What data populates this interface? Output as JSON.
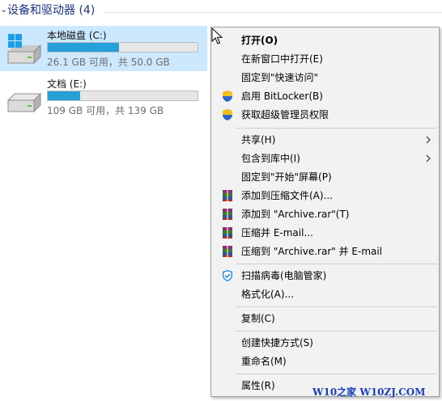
{
  "section": {
    "title": "设备和驱动器 (4)"
  },
  "drives": [
    {
      "name": "本地磁盘 (C:)",
      "info": "26.1 GB 可用，共 50.0 GB",
      "used_fraction": 0.478,
      "selected": true,
      "icon": "windows-drive-icon"
    },
    {
      "name": "文档 (E:)",
      "info": "109 GB 可用，共 139 GB",
      "used_fraction": 0.216,
      "selected": false,
      "icon": "hard-drive-icon"
    }
  ],
  "context_menu": {
    "items": [
      {
        "label": "打开(O)",
        "bold": true
      },
      {
        "label": "在新窗口中打开(E)"
      },
      {
        "label": "固定到\"快速访问\""
      },
      {
        "label": "启用 BitLocker(B)",
        "icon": "uac-shield-icon"
      },
      {
        "label": "获取超级管理员权限",
        "icon": "uac-shield-icon"
      },
      {
        "label": "共享(H)",
        "submenu": true
      },
      {
        "label": "包含到库中(I)",
        "submenu": true
      },
      {
        "label": "固定到\"开始\"屏幕(P)"
      },
      {
        "label": "添加到压缩文件(A)...",
        "icon": "winrar-icon"
      },
      {
        "label": "添加到 \"Archive.rar\"(T)",
        "icon": "winrar-icon"
      },
      {
        "label": "压缩并 E-mail...",
        "icon": "winrar-icon"
      },
      {
        "label": "压缩到 \"Archive.rar\" 并 E-mail",
        "icon": "winrar-icon"
      },
      {
        "label": "扫描病毒(电脑管家)",
        "icon": "tencent-pc-manager-icon"
      },
      {
        "label": "格式化(A)..."
      },
      {
        "label": "复制(C)"
      },
      {
        "label": "创建快捷方式(S)"
      },
      {
        "label": "重命名(M)"
      },
      {
        "label": "属性(R)"
      }
    ]
  },
  "watermark": "W10之家 W10ZJ.COM",
  "colors": {
    "selection": "#cce8ff",
    "drive_bar_fill": "#26a0da",
    "menu_background": "#f2f2f2",
    "section_title": "#1e3287",
    "watermark": "#1b3fbd"
  }
}
